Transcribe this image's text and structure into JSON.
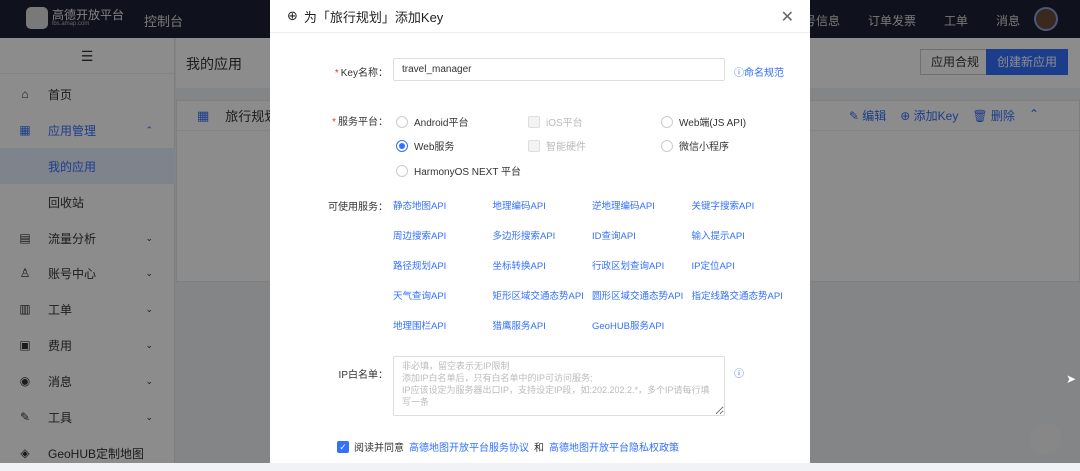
{
  "header": {
    "logo_text": "高德开放平台",
    "logo_sub": "lbs.amap.com",
    "console": "控制台",
    "nav": [
      "账号信息",
      "订单发票",
      "工单",
      "消息"
    ]
  },
  "sidebar": {
    "items": [
      {
        "label": "首页",
        "icon": "⌂"
      },
      {
        "label": "应用管理",
        "icon": "▦",
        "arrow": "⌃"
      },
      {
        "label": "我的应用"
      },
      {
        "label": "回收站"
      },
      {
        "label": "流量分析",
        "icon": "▤",
        "arrow": "⌄"
      },
      {
        "label": "账号中心",
        "icon": "♙",
        "arrow": "⌄"
      },
      {
        "label": "工单",
        "icon": "▥",
        "arrow": "⌄"
      },
      {
        "label": "费用",
        "icon": "▣",
        "arrow": "⌄"
      },
      {
        "label": "消息",
        "icon": "◉",
        "arrow": "⌄"
      },
      {
        "label": "工具",
        "icon": "✎",
        "arrow": "⌄"
      },
      {
        "label": "GeoHUB定制地图",
        "icon": "◈"
      }
    ]
  },
  "page": {
    "title": "我的应用",
    "compliance_btn": "应用合规",
    "create_btn": "创建新应用",
    "app_name": "旅行规划",
    "edit": "编辑",
    "add_key": "添加Key",
    "delete": "删除"
  },
  "modal": {
    "title": "为「旅行规划」添加Key",
    "key_label": "Key名称：",
    "key_value": "travel_manager",
    "naming_rule": "命名规范",
    "platform_label": "服务平台：",
    "platforms": [
      {
        "label": "Android平台",
        "state": "off"
      },
      {
        "label": "iOS平台",
        "state": "disabled"
      },
      {
        "label": "Web端(JS API)",
        "state": "off"
      },
      {
        "label": "Web服务",
        "state": "on"
      },
      {
        "label": "智能硬件",
        "state": "disabled"
      },
      {
        "label": "微信小程序",
        "state": "off"
      },
      {
        "label": "HarmonyOS NEXT 平台",
        "state": "off"
      }
    ],
    "services_label": "可使用服务：",
    "services": [
      "静态地图API",
      "地理编码API",
      "逆地理编码API",
      "关键字搜索API",
      "周边搜索API",
      "多边形搜索API",
      "ID查询API",
      "输入提示API",
      "路径规划API",
      "坐标转换API",
      "行政区划查询API",
      "IP定位API",
      "天气查询API",
      "矩形区域交通态势API",
      "圆形区域交通态势API",
      "指定线路交通态势API",
      "地理围栏API",
      "猎鹰服务API",
      "GeoHUB服务API"
    ],
    "ip_label": "IP白名单：",
    "ip_placeholder": "非必填，留空表示无IP限制\n添加IP白名单后，只有白名单中的IP可访问服务;\nIP应该设定为服务器出口IP，支持设定IP段，如:202.202.2.*，多个IP请每行填写一条",
    "agree_text": "阅读并同意",
    "agree_link1": "高德地图开放平台服务协议",
    "agree_and": "和",
    "agree_link2": "高德地图开放平台隐私权政策"
  }
}
